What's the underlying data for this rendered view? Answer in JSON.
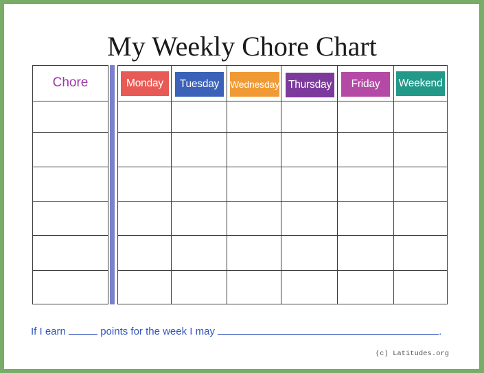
{
  "title": "My Weekly Chore Chart",
  "chart": {
    "chore_header": "Chore",
    "chore_header_color": "#9b3aa8",
    "days": [
      {
        "label": "Monday",
        "color": "#e85a55"
      },
      {
        "label": "Tuesday",
        "color": "#3b62b8"
      },
      {
        "label": "Wednesday",
        "color": "#f09a35"
      },
      {
        "label": "Thursday",
        "color": "#7c3a9c"
      },
      {
        "label": "Friday",
        "color": "#b54aa6"
      },
      {
        "label": "Weekend",
        "color": "#23998a"
      }
    ],
    "row_count": 6
  },
  "footer": {
    "color": "#3355bb",
    "part1": "If I earn",
    "part2": "points for the week I may",
    "end": "."
  },
  "copyright": "(c) Latitudes.org",
  "colors": {
    "border": "#79ac67",
    "divider_bar": "#7b80cc"
  }
}
